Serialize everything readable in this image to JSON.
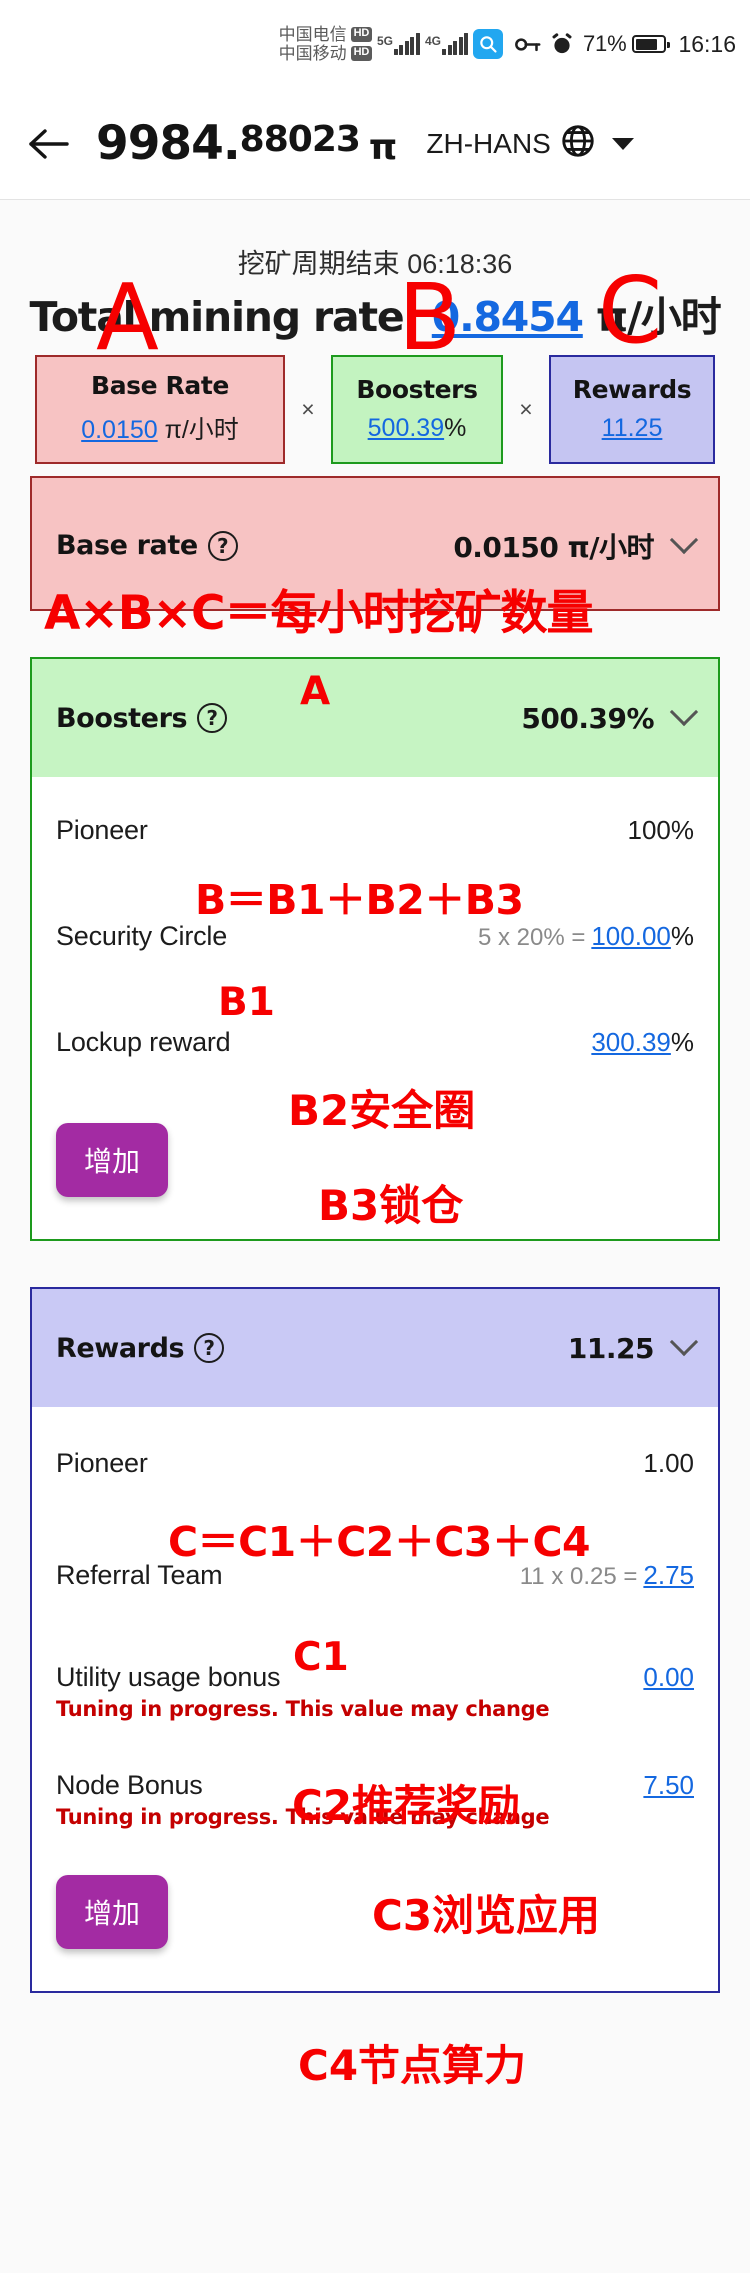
{
  "statusbar": {
    "carrier1": "中国电信",
    "carrier1_badge": "HD",
    "carrier2": "中国移动",
    "carrier2_badge": "HD",
    "network1": "5G",
    "network2": "4G",
    "search_icon": "search-icon",
    "vpn_icon": "key-icon",
    "alarm_icon": "alarm-icon",
    "battery_percent": "71%",
    "time": "16:16"
  },
  "appbar": {
    "back_icon": "back-arrow-icon",
    "balance_int": "9984",
    "balance_dot": ".",
    "balance_dec": "88023",
    "balance_unit": "π",
    "language": "ZH-HANS",
    "globe_icon": "globe-icon",
    "dropdown_icon": "chevron-down-icon"
  },
  "mining": {
    "cycle_label": "挖矿周期结束",
    "cycle_time": "06:18:36",
    "total_rate_prefix": "Total mining rate: ",
    "total_rate_value": "0.8454",
    "total_rate_unit": " π/小时"
  },
  "formula": {
    "base": {
      "title": "Base Rate",
      "value": "0.0150",
      "unit": " π/小时"
    },
    "mult1": "×",
    "boost": {
      "title": "Boosters",
      "value": "500.39",
      "unit": "%"
    },
    "mult2": "×",
    "rewards": {
      "title": "Rewards",
      "value": "11.25",
      "unit": ""
    }
  },
  "annotations": {
    "A_big": "A",
    "B_big": "B",
    "C_big": "C",
    "abc_formula": "A×B×C＝每小时挖矿数量",
    "A_row": "A",
    "B_sum": "B＝B1＋B2＋B3",
    "C_sum": "C＝C1＋C2＋C3＋C4",
    "B1": "B1",
    "B2": "B2安全圈",
    "B3": "B3锁仓",
    "C1": "C1",
    "C2": "C2推荐奖励",
    "C3": "C3浏览应用",
    "C4": "C4节点算力"
  },
  "base_rate_card": {
    "title": "Base rate",
    "help_icon": "question-mark-icon",
    "value": "0.0150 π/小时",
    "chevron_icon": "chevron-down-icon"
  },
  "boosters_card": {
    "title": "Boosters",
    "help_icon": "question-mark-icon",
    "value": "500.39%",
    "chevron_icon": "chevron-down-icon",
    "rows": [
      {
        "label": "Pioneer",
        "muted": "",
        "value": "100%",
        "is_link": false,
        "suffix": ""
      },
      {
        "label": "Security Circle",
        "muted": "5 x 20% = ",
        "value": "100.00",
        "is_link": true,
        "suffix": "%"
      },
      {
        "label": "Lockup reward",
        "muted": "",
        "value": "300.39",
        "is_link": true,
        "suffix": "%"
      }
    ],
    "add_button": "增加"
  },
  "rewards_card": {
    "title": "Rewards",
    "help_icon": "question-mark-icon",
    "value": "11.25",
    "chevron_icon": "chevron-down-icon",
    "rows": [
      {
        "label": "Pioneer",
        "muted": "",
        "value": "1.00",
        "is_link": false,
        "suffix": "",
        "note": ""
      },
      {
        "label": "Referral Team",
        "muted": "11 x 0.25 = ",
        "value": "2.75",
        "is_link": true,
        "suffix": "",
        "note": ""
      },
      {
        "label": "Utility usage bonus",
        "muted": "",
        "value": "0.00",
        "is_link": true,
        "suffix": "",
        "note": "Tuning in progress. This value may change"
      },
      {
        "label": "Node Bonus",
        "muted": "",
        "value": "7.50",
        "is_link": true,
        "suffix": "",
        "note": "Tuning in progress. This value may change"
      }
    ],
    "add_button": "增加"
  },
  "colors": {
    "base_bg": "#f7c3c3",
    "base_border": "#9e2a2a",
    "boost_bg": "#c6f4c3",
    "boost_border": "#1d9a1d",
    "rewards_bg": "#c9c9f5",
    "rewards_border": "#2a2a9e",
    "annotation_red": "#f60000",
    "link_blue": "#1468e0",
    "add_button": "#a32ba3"
  }
}
